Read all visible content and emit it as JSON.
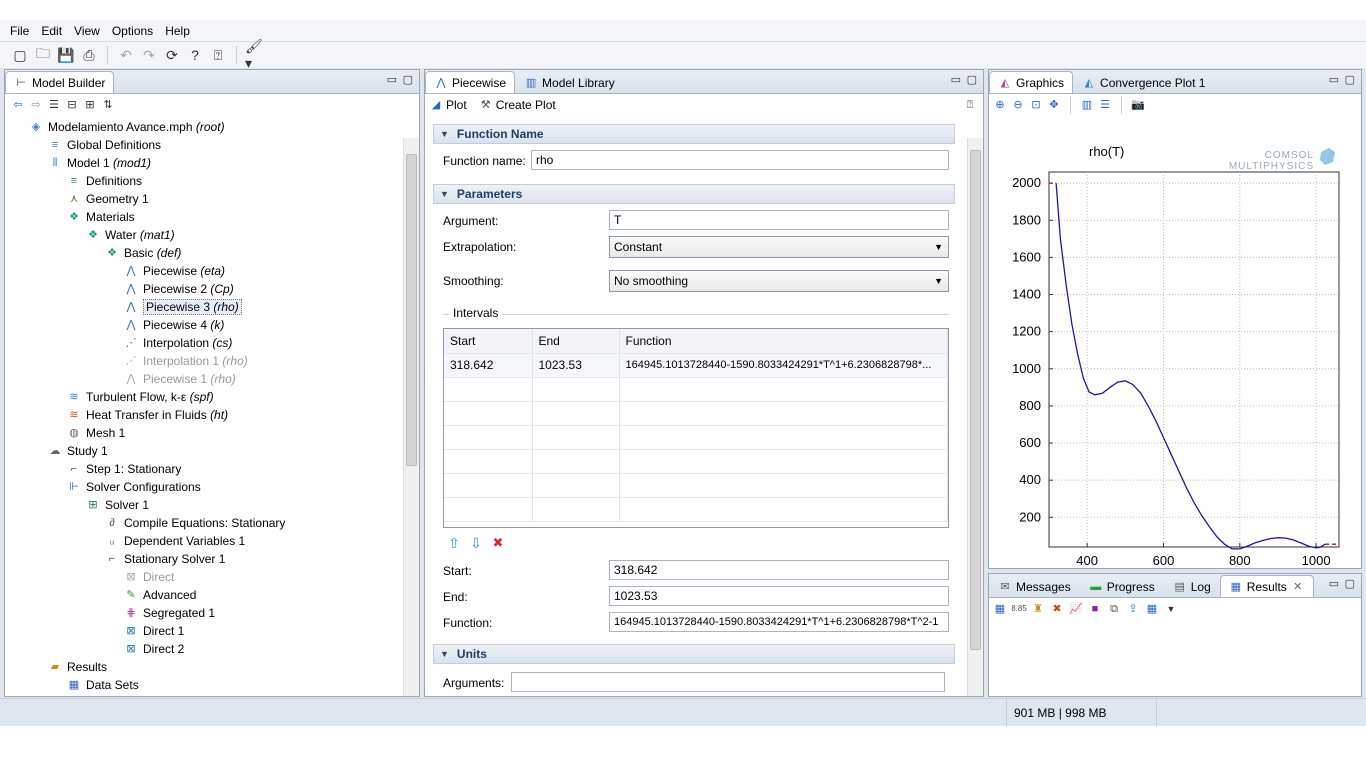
{
  "menu": [
    "File",
    "Edit",
    "View",
    "Options",
    "Help"
  ],
  "colors": {
    "accent": "#1f3d66",
    "plot_line": "#1a1aa0",
    "extrapolation": "#b01818"
  },
  "model_builder": {
    "title": "Model Builder",
    "toolbar_icons": [
      "arrow-left-icon",
      "arrow-right-icon",
      "show-icon",
      "collapse-icon",
      "expand-icon",
      "sort-icon"
    ],
    "tree": [
      {
        "label": "Modelamiento Avance.mph",
        "em": "(root)",
        "indent": 0,
        "icon": "file-icon",
        "color": "#3a7bd5"
      },
      {
        "label": "Global Definitions",
        "em": "",
        "indent": 1,
        "icon": "definitions-icon",
        "color": "#2a8c8c"
      },
      {
        "label": "Model 1",
        "em": "(mod1)",
        "indent": 1,
        "icon": "model-icon",
        "color": "#3a7bd5"
      },
      {
        "label": "Definitions",
        "em": "",
        "indent": 2,
        "icon": "definitions-icon",
        "color": "#2a8c8c"
      },
      {
        "label": "Geometry 1",
        "em": "",
        "indent": 2,
        "icon": "geometry-icon",
        "color": "#7a6a20"
      },
      {
        "label": "Materials",
        "em": "",
        "indent": 2,
        "icon": "materials-icon",
        "color": "#1a9a7a"
      },
      {
        "label": "Water",
        "em": "(mat1)",
        "indent": 3,
        "icon": "material-icon",
        "color": "#1a9a7a"
      },
      {
        "label": "Basic",
        "em": "(def)",
        "indent": 4,
        "icon": "material-icon",
        "color": "#1a9a7a"
      },
      {
        "label": "Piecewise",
        "em": "(eta)",
        "indent": 5,
        "icon": "piecewise-icon",
        "color": "#2a6ac0"
      },
      {
        "label": "Piecewise 2",
        "em": "(Cp)",
        "indent": 5,
        "icon": "piecewise-icon",
        "color": "#2a6ac0"
      },
      {
        "label": "Piecewise 3",
        "em": "(rho)",
        "indent": 5,
        "icon": "piecewise-icon",
        "color": "#2a6ac0",
        "selected": true
      },
      {
        "label": "Piecewise 4",
        "em": "(k)",
        "indent": 5,
        "icon": "piecewise-icon",
        "color": "#2a6ac0"
      },
      {
        "label": "Interpolation",
        "em": "(cs)",
        "indent": 5,
        "icon": "interpolation-icon",
        "color": "#2a6ac0"
      },
      {
        "label": "Interpolation 1",
        "em": "(rho)",
        "indent": 5,
        "icon": "interpolation-icon",
        "color": "#aaa",
        "disabled": true
      },
      {
        "label": "Piecewise 1",
        "em": "(rho)",
        "indent": 5,
        "icon": "piecewise-icon",
        "color": "#aaa",
        "disabled": true
      },
      {
        "label": "Turbulent Flow, k-ε",
        "em": "(spf)",
        "indent": 2,
        "icon": "flow-icon",
        "color": "#2a7ad0"
      },
      {
        "label": "Heat Transfer in Fluids",
        "em": "(ht)",
        "indent": 2,
        "icon": "heat-icon",
        "color": "#d05020"
      },
      {
        "label": "Mesh 1",
        "em": "",
        "indent": 2,
        "icon": "mesh-icon",
        "color": "#666"
      },
      {
        "label": "Study 1",
        "em": "",
        "indent": 1,
        "icon": "study-icon",
        "color": "#666"
      },
      {
        "label": "Step 1: Stationary",
        "em": "",
        "indent": 2,
        "icon": "step-icon",
        "color": "#555"
      },
      {
        "label": "Solver Configurations",
        "em": "",
        "indent": 2,
        "icon": "solver-config-icon",
        "color": "#2a6ac0"
      },
      {
        "label": "Solver 1",
        "em": "",
        "indent": 3,
        "icon": "solver-icon",
        "color": "#1a7a5a"
      },
      {
        "label": "Compile Equations: Stationary",
        "em": "",
        "indent": 4,
        "icon": "compile-icon",
        "color": "#555"
      },
      {
        "label": "Dependent Variables 1",
        "em": "",
        "indent": 4,
        "icon": "variables-icon",
        "color": "#555"
      },
      {
        "label": "Stationary Solver 1",
        "em": "",
        "indent": 4,
        "icon": "stationary-solver-icon",
        "color": "#555"
      },
      {
        "label": "Direct",
        "em": "",
        "indent": 5,
        "icon": "direct-icon",
        "color": "#aaa",
        "disabled": true
      },
      {
        "label": "Advanced",
        "em": "",
        "indent": 5,
        "icon": "advanced-icon",
        "color": "#2a9a3a"
      },
      {
        "label": "Segregated 1",
        "em": "",
        "indent": 5,
        "icon": "segregated-icon",
        "color": "#c03080"
      },
      {
        "label": "Direct 1",
        "em": "",
        "indent": 5,
        "icon": "direct-icon",
        "color": "#1a7a9a"
      },
      {
        "label": "Direct 2",
        "em": "",
        "indent": 5,
        "icon": "direct-icon",
        "color": "#1a7a9a"
      },
      {
        "label": "Results",
        "em": "",
        "indent": 1,
        "icon": "results-icon",
        "color": "#d09020"
      },
      {
        "label": "Data Sets",
        "em": "",
        "indent": 2,
        "icon": "datasets-icon",
        "color": "#2a6ac0"
      }
    ]
  },
  "settings": {
    "tabs": [
      "Piecewise",
      "Model Library"
    ],
    "actions": {
      "plot": "Plot",
      "create_plot": "Create Plot"
    },
    "sections": {
      "function_name": "Function Name",
      "parameters": "Parameters",
      "units": "Units"
    },
    "function_name_label": "Function name:",
    "function_name_value": "rho",
    "argument_label": "Argument:",
    "argument_value": "T",
    "extrapolation_label": "Extrapolation:",
    "extrapolation_value": "Constant",
    "smoothing_label": "Smoothing:",
    "smoothing_value": "No smoothing",
    "intervals_label": "Intervals",
    "table": {
      "headers": [
        "Start",
        "End",
        "Function"
      ],
      "rows": [
        [
          "318.642",
          "1023.53",
          "164945.1013728440-1590.8033424291*T^1+6.2306828798*..."
        ]
      ]
    },
    "start_label": "Start:",
    "start_value": "318.642",
    "end_label": "End:",
    "end_value": "1023.53",
    "function_label": "Function:",
    "function_value": "164945.1013728440-1590.8033424291*T^1+6.2306828798*T^2-1",
    "arguments_label": "Arguments:",
    "arguments_value": ""
  },
  "graphics": {
    "tabs": [
      "Graphics",
      "Convergence Plot 1"
    ],
    "logo_line1": "COMSOL",
    "logo_line2": "MULTIPHYSICS"
  },
  "chart_data": {
    "type": "line",
    "title": "rho(T)",
    "xlabel": "",
    "ylabel": "",
    "xlim": [
      300,
      1060
    ],
    "ylim": [
      40,
      2060
    ],
    "xticks": [
      400,
      600,
      800,
      1000
    ],
    "yticks": [
      200,
      400,
      600,
      800,
      1000,
      1200,
      1400,
      1600,
      1800,
      2000
    ],
    "grid": true,
    "series": [
      {
        "x": [
          318.642,
          330,
          345,
          360,
          375,
          390,
          405,
          420,
          440,
          460,
          480,
          500,
          520,
          540,
          560,
          580,
          600,
          620,
          640,
          660,
          680,
          700,
          720,
          740,
          760,
          780,
          800,
          820,
          840,
          860,
          880,
          900,
          920,
          940,
          960,
          980,
          1000,
          1010,
          1023.53
        ],
        "y": [
          2000,
          1700,
          1450,
          1240,
          1080,
          950,
          875,
          860,
          868,
          900,
          928,
          935,
          915,
          870,
          800,
          720,
          630,
          540,
          450,
          360,
          280,
          210,
          150,
          95,
          55,
          30,
          30,
          45,
          62,
          75,
          85,
          90,
          88,
          78,
          62,
          45,
          35,
          38,
          55
        ]
      },
      {
        "x": [
          300,
          318.642
        ],
        "y": [
          2000,
          2000
        ]
      },
      {
        "x": [
          1023.53,
          1060
        ],
        "y": [
          55,
          55
        ]
      }
    ]
  },
  "bottom_panel": {
    "tabs": [
      "Messages",
      "Progress",
      "Log",
      "Results"
    ]
  },
  "status": {
    "memory": "901 MB | 998 MB"
  }
}
